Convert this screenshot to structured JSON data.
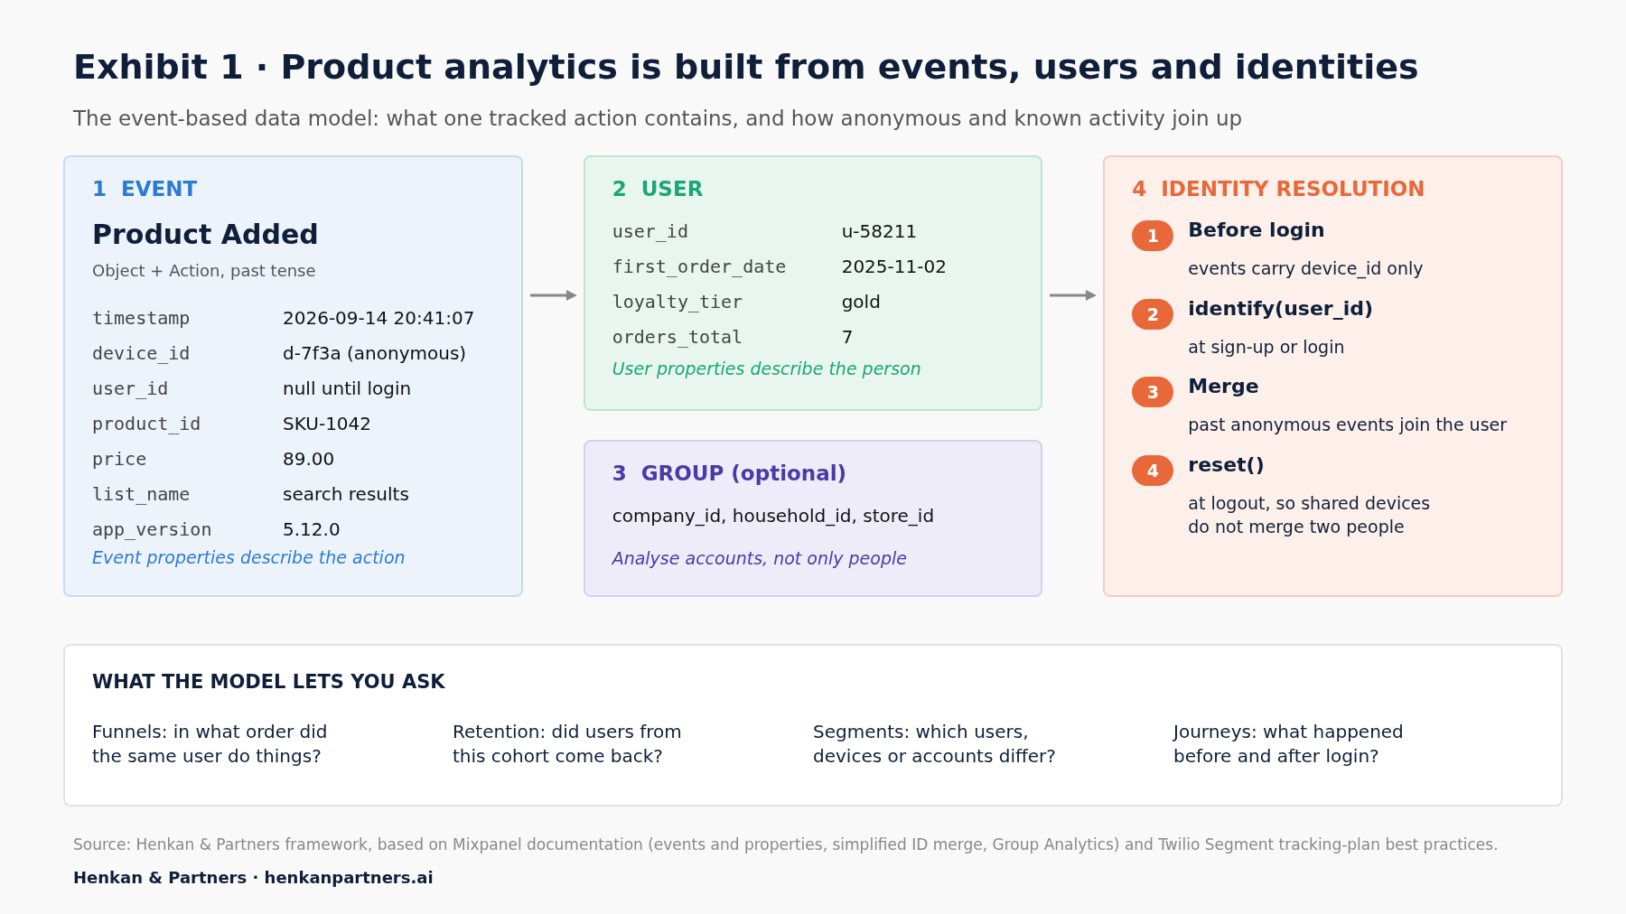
{
  "title": "Exhibit 1 · Product analytics is built from events, users and identities",
  "subtitle": "The event-based data model: what one tracked action contains, and how anonymous and known activity join up",
  "event": {
    "number": "1",
    "heading": "EVENT",
    "name": "Product Added",
    "hint": "Object + Action, past tense",
    "properties": [
      {
        "key": "timestamp",
        "value": "2026-09-14 20:41:07"
      },
      {
        "key": "device_id",
        "value": "d-7f3a (anonymous)"
      },
      {
        "key": "user_id",
        "value": "null until login"
      },
      {
        "key": "product_id",
        "value": "SKU-1042"
      },
      {
        "key": "price",
        "value": "89.00"
      },
      {
        "key": "list_name",
        "value": "search results"
      },
      {
        "key": "app_version",
        "value": "5.12.0"
      }
    ],
    "note": "Event properties describe the action"
  },
  "user": {
    "number": "2",
    "heading": "USER",
    "properties": [
      {
        "key": "user_id",
        "value": "u-58211"
      },
      {
        "key": "first_order_date",
        "value": "2025-11-02"
      },
      {
        "key": "loyalty_tier",
        "value": "gold"
      },
      {
        "key": "orders_total",
        "value": "7"
      }
    ],
    "note": "User properties describe the person"
  },
  "group": {
    "number": "3",
    "heading": "GROUP (optional)",
    "keys": "company_id, household_id, store_id",
    "note": "Analyse accounts, not only people"
  },
  "identity": {
    "number": "4",
    "heading": "IDENTITY RESOLUTION",
    "steps": [
      {
        "number": "1",
        "title": "Before login",
        "text": "events carry device_id only"
      },
      {
        "number": "2",
        "title": "identify(user_id)",
        "text": "at sign-up or login"
      },
      {
        "number": "3",
        "title": "Merge",
        "text": "past anonymous events join the user"
      },
      {
        "number": "4",
        "title": "reset()",
        "text": "at logout, so shared devices\ndo not merge two people"
      }
    ]
  },
  "questions": {
    "heading": "WHAT THE MODEL LETS YOU ASK",
    "items": [
      "Funnels: in what order did\nthe same user do things?",
      "Retention: did users from\nthis cohort come back?",
      "Segments: which users,\ndevices or accounts differ?",
      "Journeys: what happened\nbefore and after login?"
    ]
  },
  "source": "Source: Henkan & Partners framework, based on Mixpanel documentation (events and properties, simplified ID merge, Group Analytics) and Twilio Segment tracking-plan best practices.",
  "brand": "Henkan & Partners · henkanpartners.ai"
}
